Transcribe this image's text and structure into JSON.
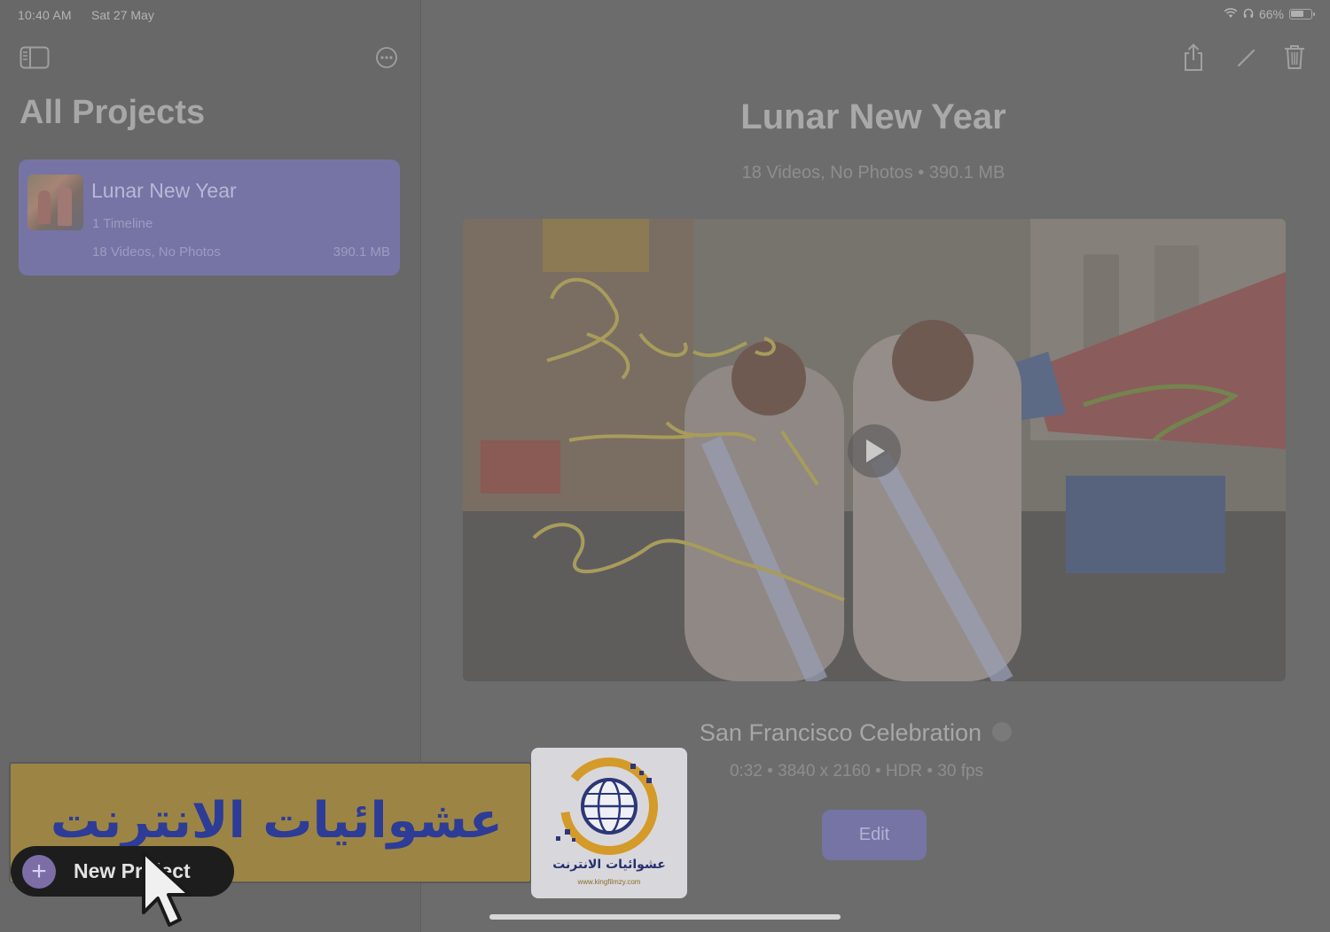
{
  "status_bar": {
    "time": "10:40 AM",
    "date": "Sat 27 May",
    "battery": "66%",
    "battery_level": 0.66
  },
  "sidebar": {
    "title": "All Projects",
    "toolbar_icons": [
      "sidebar-toggle-icon",
      "more-ellipsis-icon"
    ],
    "projects": [
      {
        "title": "Lunar New Year",
        "timelines": "1 Timeline",
        "meta": "18 Videos, No Photos",
        "size": "390.1 MB",
        "selected": true
      }
    ]
  },
  "main": {
    "toolbar_icons": [
      "share-icon",
      "pencil-icon",
      "trash-icon"
    ],
    "title": "Lunar New Year",
    "subtitle": "18 Videos, No Photos • 390.1 MB",
    "clip": {
      "title": "San Francisco Celebration",
      "meta": "0:32 • 3840 x 2160 • HDR • 30 fps"
    },
    "edit_label": "Edit"
  },
  "new_project_label": "New Project",
  "watermark": {
    "banner_text": "عشوائيات الانترنت",
    "logo_text": "عشوائيات الانترنت",
    "logo_url": "www.kingfilmzy.com"
  },
  "colors": {
    "accent": "#7674a5",
    "dim_background": "#6c6c6c",
    "banner": "#9c8544",
    "banner_text": "#2d3c96"
  }
}
